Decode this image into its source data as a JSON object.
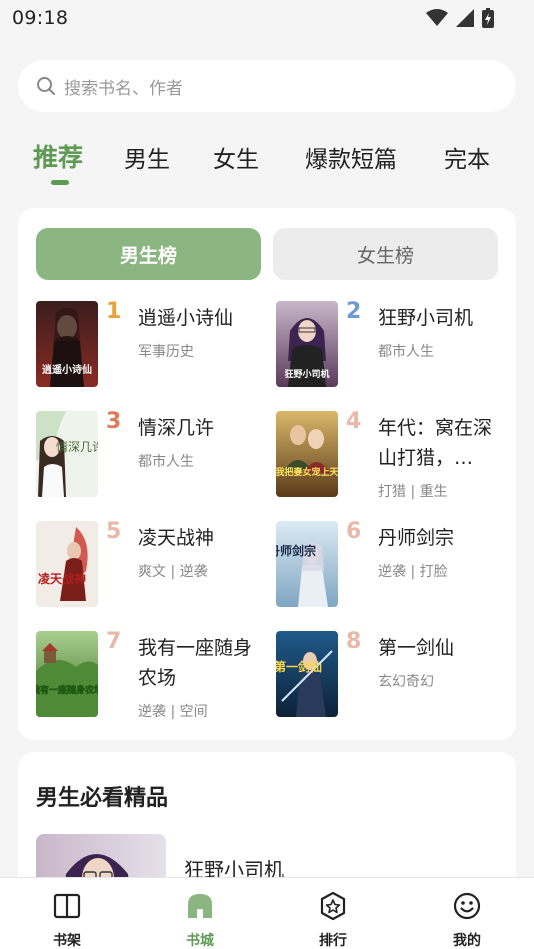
{
  "status_bar": {
    "time": "09:18",
    "icons": [
      "wifi-icon",
      "signal-icon",
      "battery-charging-icon"
    ]
  },
  "search": {
    "placeholder": "搜索书名、作者"
  },
  "tabs": [
    {
      "label": "推荐",
      "active": true
    },
    {
      "label": "男生",
      "active": false
    },
    {
      "label": "女生",
      "active": false
    },
    {
      "label": "爆款短篇",
      "active": false
    },
    {
      "label": "完本",
      "active": false
    }
  ],
  "ranking": {
    "toggle_male": "男生榜",
    "toggle_female": "女生榜",
    "selected": "男生榜",
    "rank_colors": {
      "1": "#e9a23b",
      "2": "#6b9bd1",
      "3": "#e07b5a",
      "other": "#e8b9a8"
    },
    "items": [
      {
        "rank": "1",
        "title": "逍遥小诗仙",
        "tags": "军事历史"
      },
      {
        "rank": "2",
        "title": "狂野小司机",
        "tags": "都市人生"
      },
      {
        "rank": "3",
        "title": "情深几许",
        "tags": "都市人生"
      },
      {
        "rank": "4",
        "title": "年代：窝在深山打猎，…",
        "tags": "打猎 | 重生"
      },
      {
        "rank": "5",
        "title": "凌天战神",
        "tags": "爽文 | 逆袭"
      },
      {
        "rank": "6",
        "title": "丹师剑宗",
        "tags": "逆袭 | 打脸"
      },
      {
        "rank": "7",
        "title": "我有一座随身农场",
        "tags": "逆袭 | 空间"
      },
      {
        "rank": "8",
        "title": "第一剑仙",
        "tags": "玄幻奇幻"
      }
    ]
  },
  "covers": {
    "c1": "逍遥小诗仙",
    "c2": "狂野小司机",
    "c3": "情深几许",
    "c4": "我把妻女宠上天",
    "c5": "凌天战神",
    "c6": "丹师剑宗",
    "c7": "我有一座随身农场",
    "c8": "第一剑仙"
  },
  "featured": {
    "title": "男生必看精品",
    "book_title": "狂野小司机"
  },
  "bottom_nav": [
    {
      "label": "书架",
      "icon": "book-open-icon",
      "active": false
    },
    {
      "label": "书城",
      "icon": "store-icon",
      "active": true
    },
    {
      "label": "排行",
      "icon": "star-badge-icon",
      "active": false
    },
    {
      "label": "我的",
      "icon": "smiley-icon",
      "active": false
    }
  ]
}
